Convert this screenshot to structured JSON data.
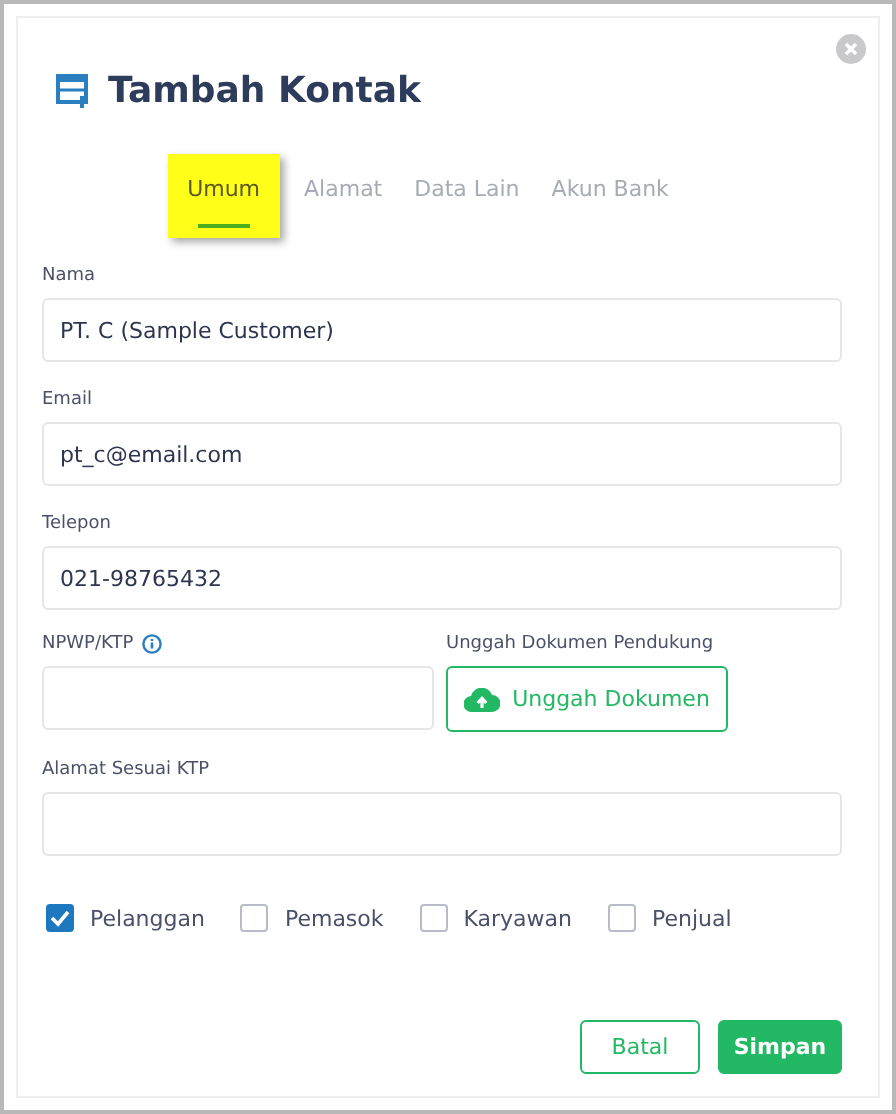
{
  "dialog": {
    "title": "Tambah Kontak"
  },
  "tabs": [
    {
      "label": "Umum",
      "selected": true
    },
    {
      "label": "Alamat",
      "selected": false
    },
    {
      "label": "Data Lain",
      "selected": false
    },
    {
      "label": "Akun Bank",
      "selected": false
    }
  ],
  "fields": [
    {
      "label": "Nama",
      "value": "PT. C (Sample Customer)"
    },
    {
      "label": "Email",
      "value": "pt_c@email.com"
    },
    {
      "label": "Telepon",
      "value": "021-98765432"
    }
  ],
  "npwp": {
    "label": "NPWP/KTP"
  },
  "upload": {
    "label": "Unggah Dokumen Pendukung",
    "button": "Unggah Dokumen"
  },
  "address": {
    "label": "Alamat Sesuai KTP"
  },
  "roles": [
    {
      "label": "Pelanggan",
      "checked": true
    },
    {
      "label": "Pemasok",
      "checked": false
    },
    {
      "label": "Karyawan",
      "checked": false
    },
    {
      "label": "Penjual",
      "checked": false
    }
  ],
  "buttons": {
    "cancel": "Batal",
    "save": "Simpan"
  }
}
